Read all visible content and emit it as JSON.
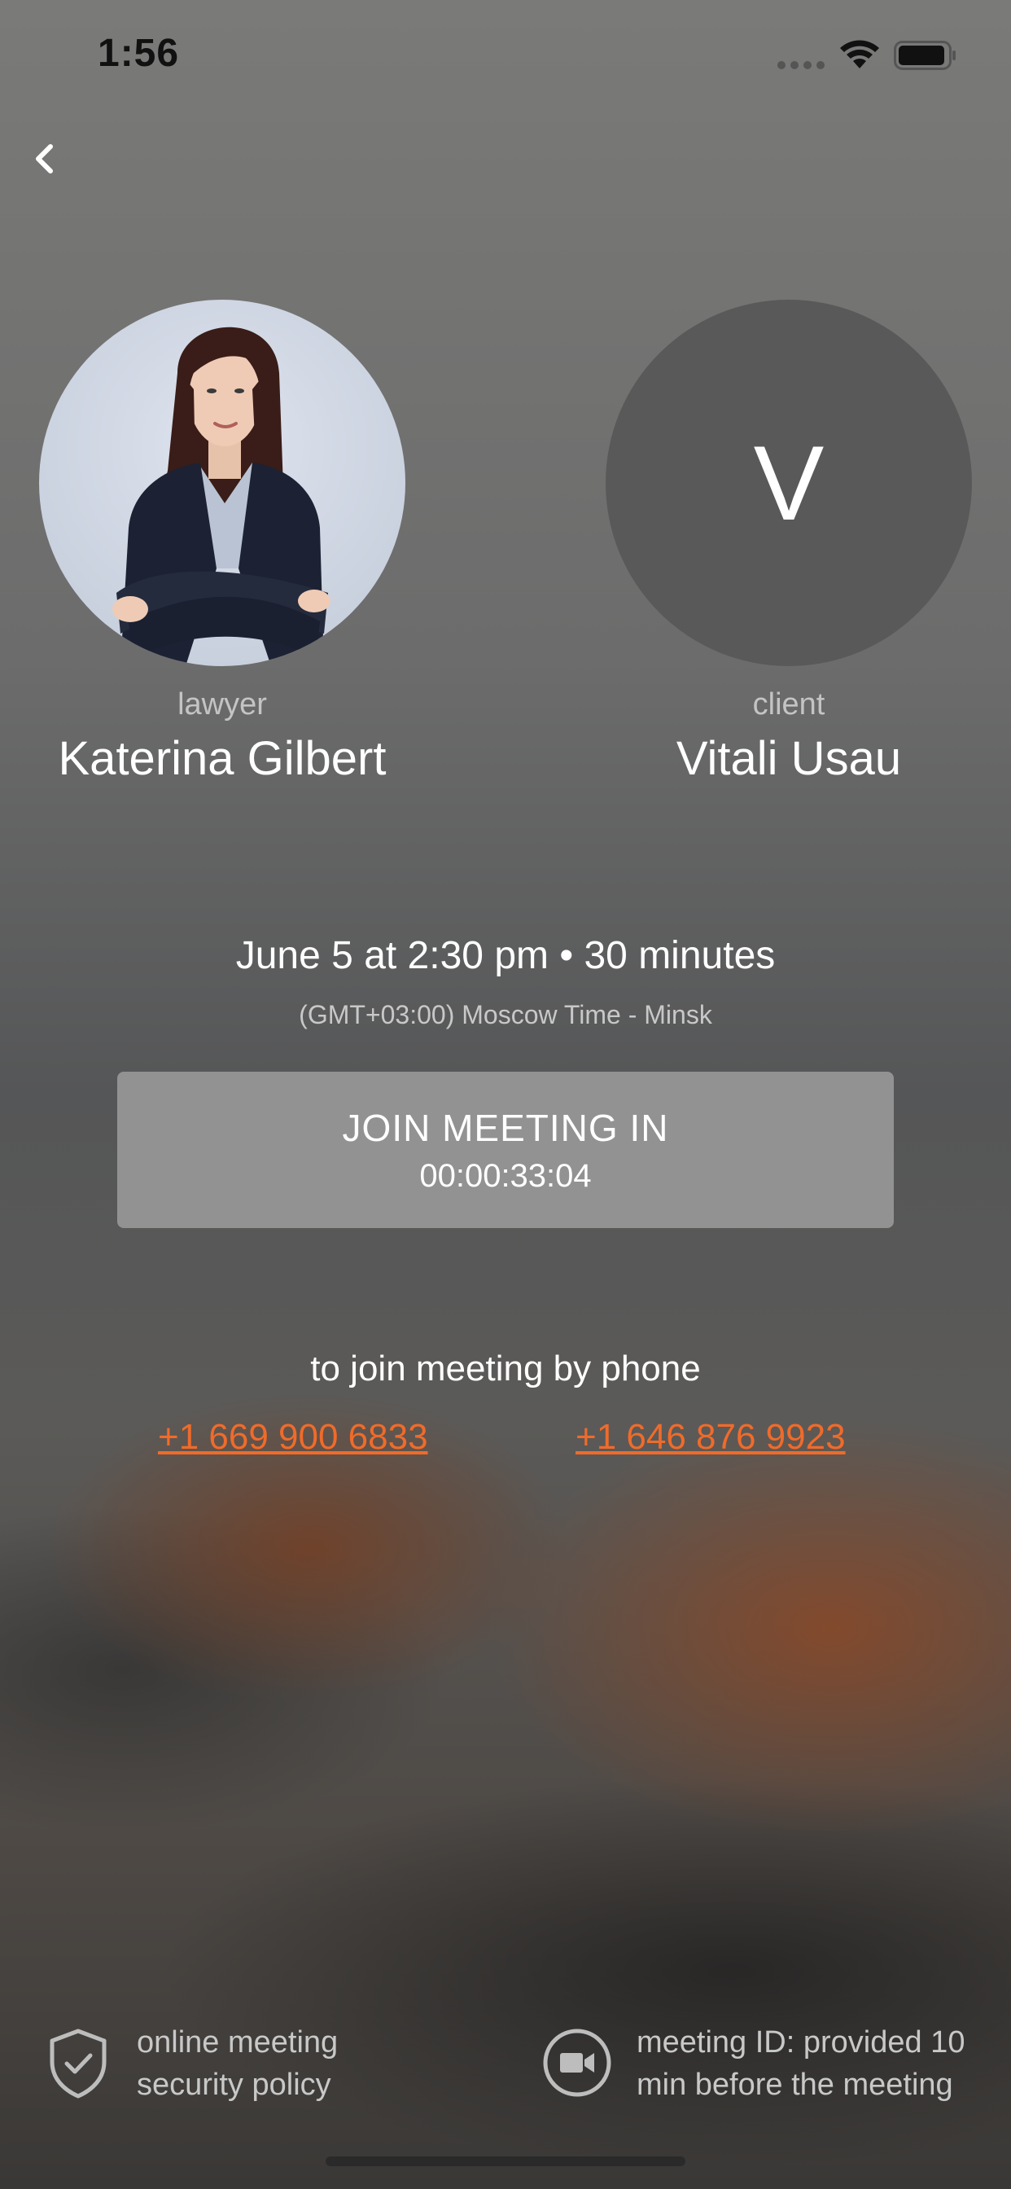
{
  "status_bar": {
    "time": "1:56",
    "wifi_icon": "wifi-icon",
    "battery_icon": "battery-icon"
  },
  "nav": {
    "back_icon": "chevron-left-icon"
  },
  "participants": [
    {
      "role": "lawyer",
      "name": "Katerina Gilbert",
      "avatar": "photo"
    },
    {
      "role": "client",
      "name": "Vitali Usau",
      "avatar_initial": "V"
    }
  ],
  "meeting": {
    "datetime": "June 5 at 2:30 pm • 30 minutes",
    "timezone": "(GMT+03:00) Moscow Time - Minsk"
  },
  "join_button": {
    "label": "JOIN MEETING IN",
    "countdown": "00:00:33:04"
  },
  "phone": {
    "caption": "to join meeting by phone",
    "numbers": [
      "+1 669 900 6833",
      "+1 646 876 9923"
    ]
  },
  "footer": {
    "security": {
      "icon": "shield-check-icon",
      "line1": "online meeting",
      "line2": "security policy"
    },
    "meeting_id": {
      "icon": "video-camera-icon",
      "line1": "meeting ID: provided 10",
      "line2": "min before the meeting"
    }
  },
  "colors": {
    "accent_link": "#f06b2a",
    "button_bg": "#929292",
    "avatar_bg": "#595959"
  }
}
